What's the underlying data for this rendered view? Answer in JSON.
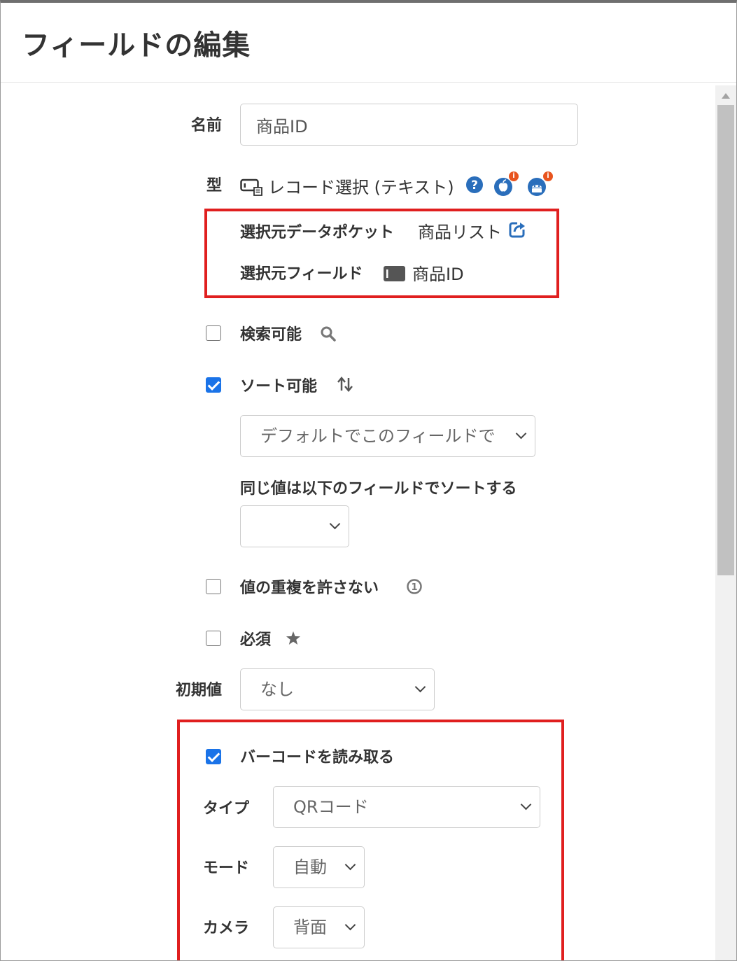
{
  "dialog": {
    "title": "フィールドの編集"
  },
  "name_field": {
    "label": "名前",
    "value": "商品ID"
  },
  "type_field": {
    "label": "型",
    "value": "レコード選択 (テキスト)"
  },
  "source": {
    "pocket_label": "選択元データポケット",
    "pocket_value": "商品リスト",
    "field_label": "選択元フィールド",
    "field_value": "商品ID"
  },
  "searchable": {
    "label": "検索可能",
    "checked": false
  },
  "sortable": {
    "label": "ソート可能",
    "checked": true,
    "default_sort_select": "デフォルトでこのフィールドで",
    "tie_label": "同じ値は以下のフィールドでソートする",
    "tie_select": ""
  },
  "unique": {
    "label": "値の重複を許さない",
    "checked": false,
    "info_glyph": "1"
  },
  "required": {
    "label": "必須",
    "checked": false
  },
  "initial_value": {
    "label": "初期値",
    "value": "なし"
  },
  "barcode": {
    "label": "バーコードを読み取る",
    "checked": true,
    "type_label": "タイプ",
    "type_value": "QRコード",
    "mode_label": "モード",
    "mode_value": "自動",
    "camera_label": "カメラ",
    "camera_value": "背面"
  },
  "icons": {
    "help": "question-circle-icon",
    "ios": "apple-icon",
    "android": "android-icon",
    "platform_badge": "i",
    "external_link": "external-link-icon",
    "search": "search-icon",
    "sort": "sort-arrows-icon",
    "required": "star-icon"
  },
  "colors": {
    "accent": "#1a73e8",
    "highlight_border": "#e01f1f",
    "link": "#2a6ebb"
  }
}
